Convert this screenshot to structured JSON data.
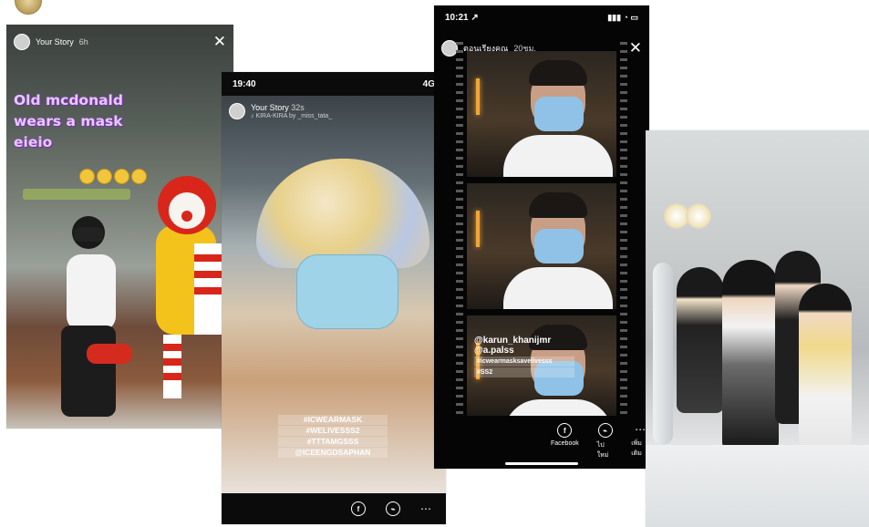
{
  "stories": [
    {
      "header": {
        "name": "Your Story",
        "time": "6h"
      },
      "caption": [
        "Old mcdonald",
        "wears a mask",
        "eieio"
      ],
      "close_icon": "close-icon"
    },
    {
      "status": {
        "time": "19:40",
        "network": "4G"
      },
      "header": {
        "name": "Your Story",
        "time": "32s",
        "music": "♪ KIRA-KIRA by _miss_tata_"
      },
      "hashtags": [
        "#ICWEARMASK",
        "#WELIVESSS2",
        "#TTTAMGSSS",
        "@ICEENGDSAPHAN"
      ],
      "footer": {
        "share_icon": "facebook-icon",
        "message_icon": "messenger-icon",
        "more_icon": "more-icon"
      }
    },
    {
      "status": {
        "time": "10:21 ↗"
      },
      "header": {
        "name": "ตอนเรียงคุณ",
        "time": "20ชม."
      },
      "mentions": [
        "@karun_khanijmr",
        "@a.palss",
        "#icwearmasksavelivesss",
        "#SS2"
      ],
      "actions": [
        {
          "icon": "facebook-icon",
          "label": "Facebook"
        },
        {
          "icon": "messenger-icon",
          "label": "ไปใหม่"
        },
        {
          "icon": "more-icon",
          "label": "เพิ่มเติม"
        }
      ]
    },
    {
      "description_icon": "photo"
    }
  ],
  "colors": {
    "caption": "#e9c7ff",
    "text": "#ffffff",
    "dark": "#0b0b0b"
  }
}
